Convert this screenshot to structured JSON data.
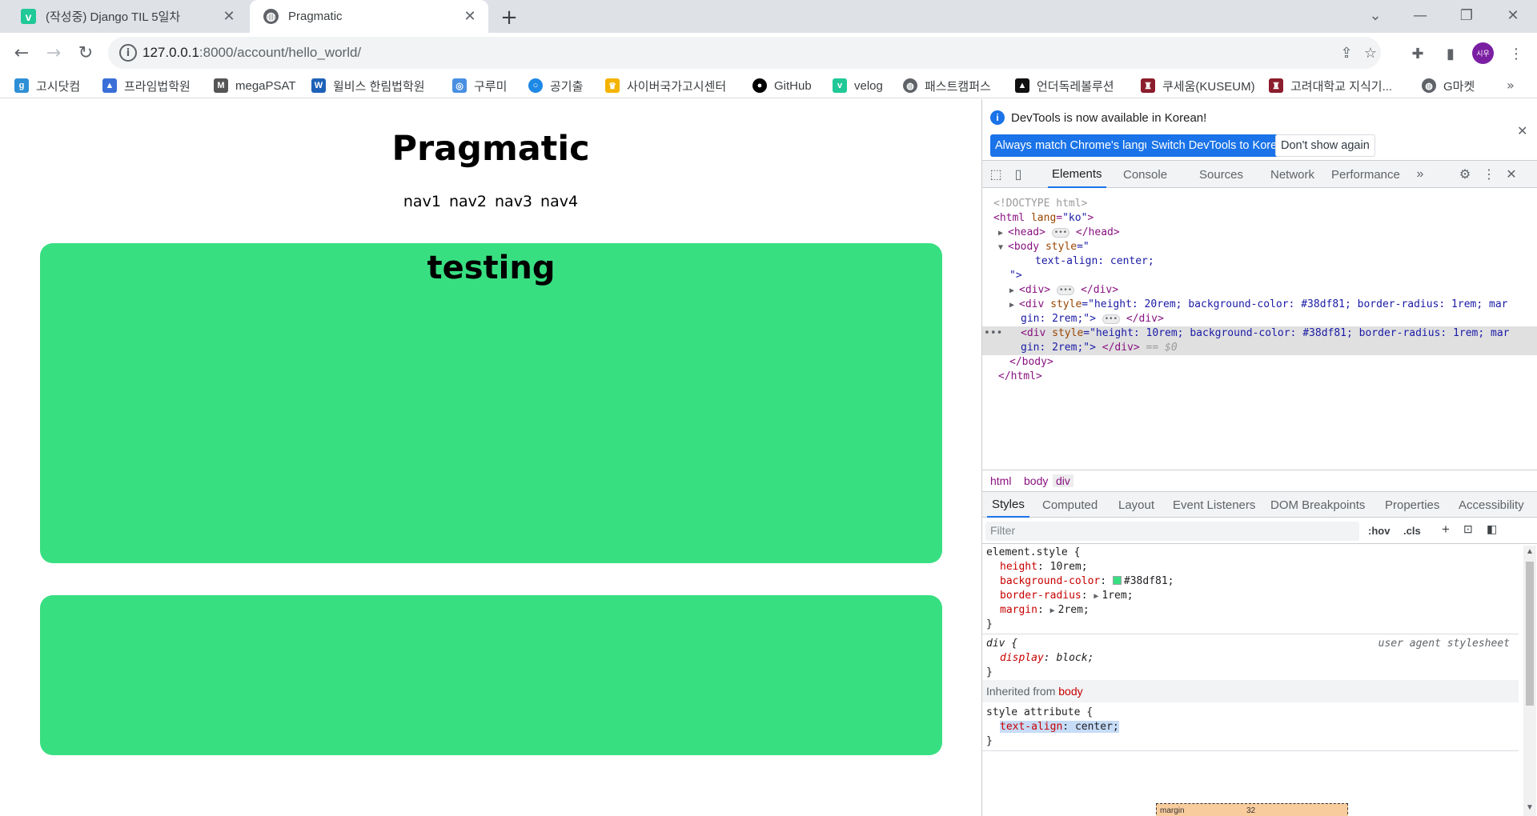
{
  "browser": {
    "tabs": [
      {
        "title": "(작성중) Django TIL 5일차",
        "icon": "velog-icon",
        "active": false
      },
      {
        "title": "Pragmatic",
        "icon": "globe-icon",
        "active": true
      }
    ],
    "url_host": "127.0.0.1",
    "url_path": ":8000/account/hello_world/",
    "avatar_text": "시우",
    "bookmarks": [
      {
        "label": "고시닷컴",
        "icon": "gosi-icon",
        "color": "#2f8fd6"
      },
      {
        "label": "프라임법학원",
        "icon": "prime-icon",
        "color": "#3b6fd8"
      },
      {
        "label": "megaPSAT",
        "icon": "mega-icon",
        "color": "#555555"
      },
      {
        "label": "윌비스 한림법학원",
        "icon": "willbes-icon",
        "color": "#1d62b8"
      },
      {
        "label": "구루미",
        "icon": "gurumi-icon",
        "color": "#4a90e2"
      },
      {
        "label": "공기출",
        "icon": "gonggichul-icon",
        "color": "#1e88e5"
      },
      {
        "label": "사이버국가고시센터",
        "icon": "cyber-icon",
        "color": "#f4b400"
      },
      {
        "label": "GitHub",
        "icon": "github-icon",
        "color": "#000000"
      },
      {
        "label": "velog",
        "icon": "velog-icon",
        "color": "#20c997"
      },
      {
        "label": "패스트캠퍼스",
        "icon": "globe-icon",
        "color": "#5f6368"
      },
      {
        "label": "언더독레볼루션",
        "icon": "underdog-icon",
        "color": "#111111"
      },
      {
        "label": "쿠세움(KUSEUM)",
        "icon": "kuseum-icon",
        "color": "#8b1d2c"
      },
      {
        "label": "고려대학교 지식기...",
        "icon": "korea-univ-icon",
        "color": "#8b1d2c"
      },
      {
        "label": "G마켓",
        "icon": "globe-icon",
        "color": "#5f6368"
      }
    ]
  },
  "page": {
    "heading": "Pragmatic",
    "nav": "nav1 nav2 nav3 nav4",
    "box1_text": "testing",
    "box_color": "#38df81"
  },
  "devtools": {
    "banner_text": "DevTools is now available in Korean!",
    "btn_match": "Always match Chrome's language",
    "btn_switch": "Switch DevTools to Korean",
    "btn_dont": "Don't show again",
    "tabs": [
      "Elements",
      "Console",
      "Sources",
      "Network",
      "Performance"
    ],
    "dom": {
      "doctype": "<!DOCTYPE html>",
      "html_open": "<html ",
      "html_attr": "lang",
      "html_val": "\"ko\"",
      "head_open": "<head>",
      "head_close": "</head>",
      "body_open": "<body ",
      "body_attr": "style",
      "body_val1": "=\"",
      "body_css": "text-align: center;",
      "body_val2": "\">",
      "div1_open": "<div>",
      "div1_close": "</div>",
      "div_tag": "<div ",
      "div_attr": "style",
      "div2_val_a": "=\"height: 20rem; background-color: #38df81; border-radius: 1rem; mar",
      "div2_val_b": "gin: 2rem;\">",
      "div3_val_a": "=\"height: 10rem; background-color: #38df81; border-radius: 1rem; mar",
      "div3_val_b": "gin: 2rem;\">",
      "div_close": "</div>",
      "eq_ref": "== $0",
      "body_close": "</body>",
      "html_close": "</html>"
    },
    "crumbs": [
      "html",
      "body",
      "div"
    ],
    "subtabs": [
      "Styles",
      "Computed",
      "Layout",
      "Event Listeners",
      "DOM Breakpoints",
      "Properties",
      "Accessibility"
    ],
    "filter_placeholder": "Filter",
    "hov": ":hov",
    "cls": ".cls",
    "styles": {
      "element_selector": "element.style {",
      "p_height": "height",
      "v_height": "10rem;",
      "p_bg": "background-color",
      "v_bg": "#38df81;",
      "p_radius": "border-radius",
      "v_radius": "1rem;",
      "p_margin": "margin",
      "v_margin": "2rem;",
      "close": "}",
      "div_selector": "div {",
      "ua_source": "user agent stylesheet",
      "p_display": "display",
      "v_display": "block;",
      "inherited_label": "Inherited from ",
      "inherited_from": "body",
      "attr_selector": "style attribute {",
      "p_align": "text-align",
      "v_align": "center;"
    },
    "boxmodel_label": "margin",
    "boxmodel_value": "32"
  }
}
